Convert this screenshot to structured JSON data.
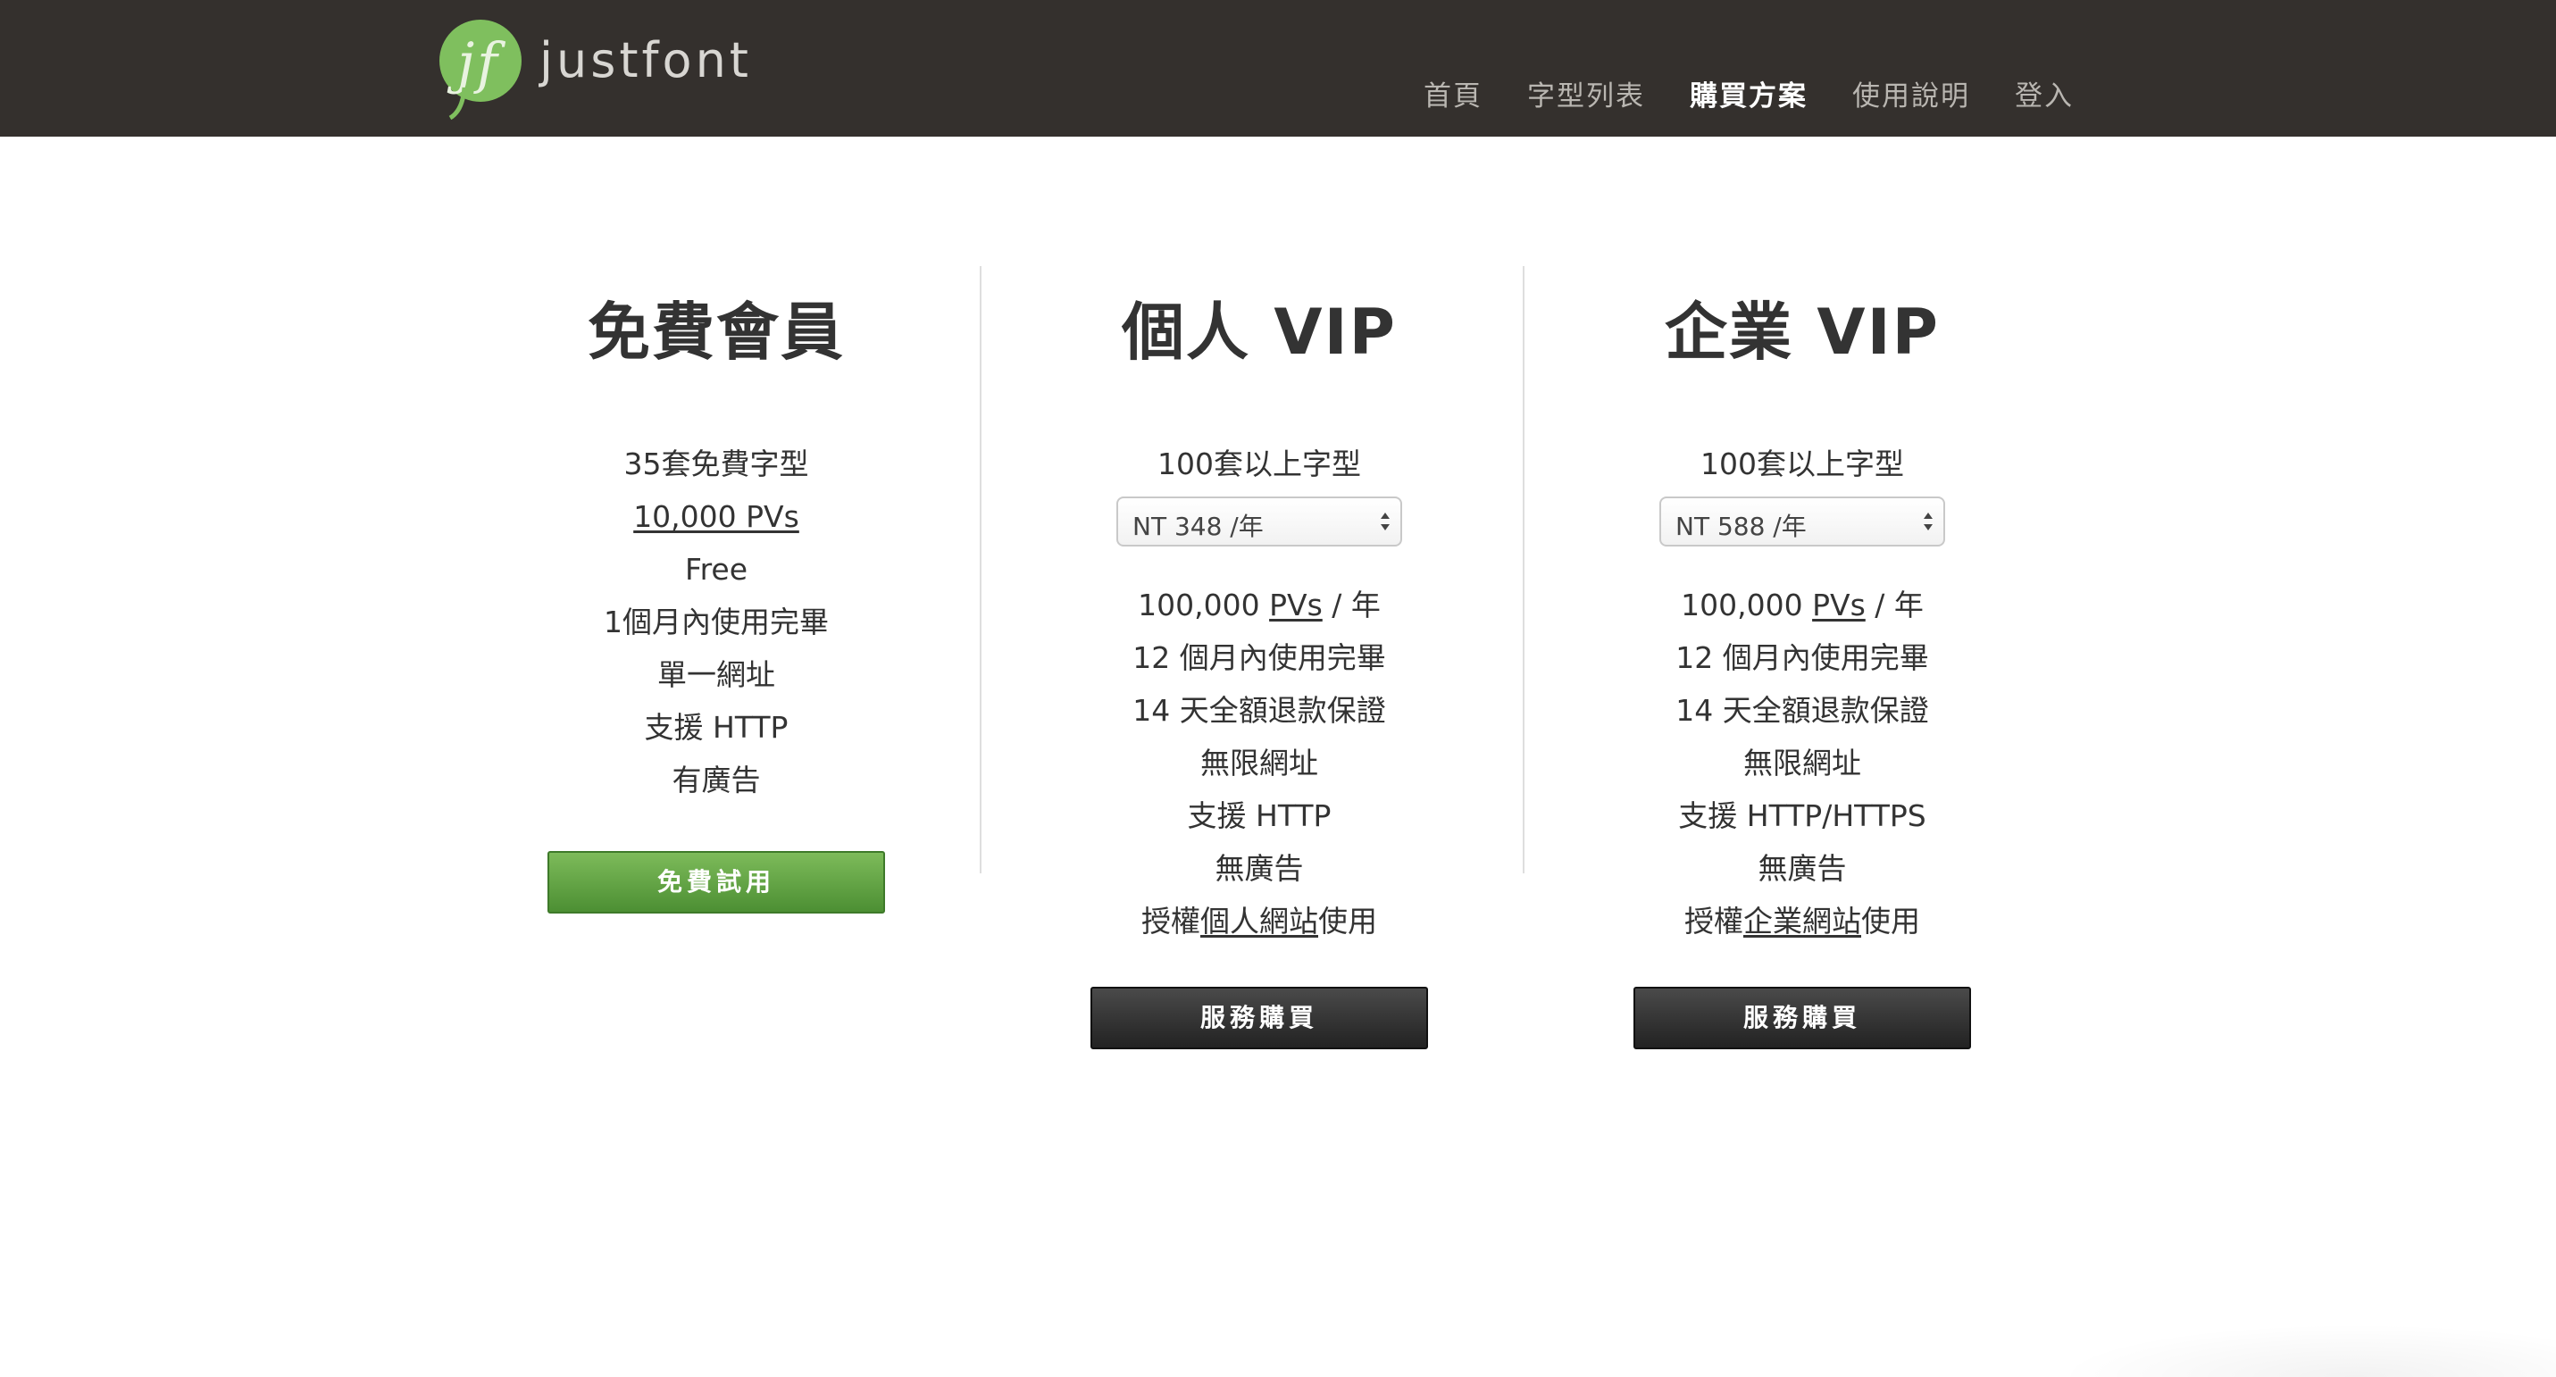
{
  "brand": {
    "name": "justfont",
    "logo_icon": "jf-logo-icon",
    "logo_color": "#7fbf5e"
  },
  "nav": {
    "items": [
      {
        "label": "首頁"
      },
      {
        "label": "字型列表"
      },
      {
        "label": "購買方案",
        "active": true
      },
      {
        "label": "使用說明"
      },
      {
        "label": "登入"
      }
    ]
  },
  "plans": {
    "free": {
      "title": "免費會員",
      "features": [
        "35套免費字型",
        "10,000 PVs",
        "Free",
        "1個月內使用完畢",
        "單一網址",
        "支援 HTTP",
        "有廣告"
      ],
      "button": "免費試用"
    },
    "personal": {
      "title": "個人 VIP",
      "fonts": "100套以上字型",
      "price_select": "NT 348 /年",
      "pv_amount": "100,000",
      "pv_unit": "PVs",
      "pv_period": " / 年",
      "features": [
        "12 個月內使用完畢",
        "14 天全額退款保證",
        "無限網址",
        "支援 HTTP",
        "無廣告"
      ],
      "license_prefix": "授權",
      "license_target": "個人網站",
      "license_suffix": "使用",
      "button": "服務購買"
    },
    "business": {
      "title": "企業 VIP",
      "fonts": "100套以上字型",
      "price_select": "NT 588 /年",
      "pv_amount": "100,000",
      "pv_unit": "PVs",
      "pv_period": " / 年",
      "features": [
        "12 個月內使用完畢",
        "14 天全額退款保證",
        "無限網址",
        "支援 HTTP/HTTPS",
        "無廣告"
      ],
      "license_prefix": "授權",
      "license_target": "企業網站",
      "license_suffix": "使用",
      "button": "服務購買"
    }
  },
  "colors": {
    "header_bg": "#34302d",
    "free_button": "#5fa140",
    "buy_button": "#2b2b2b"
  }
}
